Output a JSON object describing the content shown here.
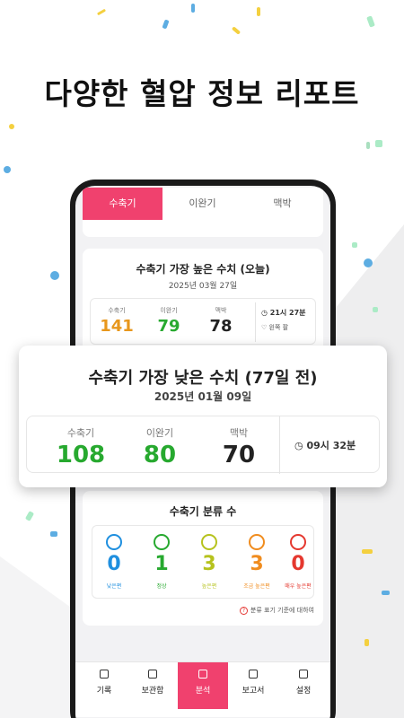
{
  "headline": "다양한 혈압 정보 리포트",
  "colors": {
    "accent": "#f0416e",
    "systolic_orange": "#e8971c",
    "green": "#27a92f",
    "dark": "#222222",
    "blue": "#1f8fdf",
    "lime": "#b6c21d",
    "orange": "#f08c1e",
    "red": "#e5382f"
  },
  "tabs": [
    {
      "label": "수축기",
      "active": true
    },
    {
      "label": "이완기",
      "active": false
    },
    {
      "label": "맥박",
      "active": false
    }
  ],
  "highest": {
    "title": "수축기 가장 높은 수치 (오늘)",
    "date": "2025년 03월 27일",
    "systolic_label": "수축기",
    "systolic": "141",
    "diastolic_label": "이완기",
    "diastolic": "79",
    "pulse_label": "맥박",
    "pulse": "78",
    "time": "21시 27분",
    "arm": "왼쪽 팔"
  },
  "lowest": {
    "title": "수축기 가장 낮은 수치 (77일 전)",
    "date": "2025년 01월 09일",
    "systolic_label": "수축기",
    "systolic": "108",
    "diastolic_label": "이완기",
    "diastolic": "80",
    "pulse_label": "맥박",
    "pulse": "70",
    "time": "09시 32분"
  },
  "classification": {
    "title": "수축기 분류 수",
    "items": [
      {
        "count": "0",
        "label": "낮은편",
        "color": "#1f8fdf"
      },
      {
        "count": "1",
        "label": "정상",
        "color": "#27a92f"
      },
      {
        "count": "3",
        "label": "높은편",
        "color": "#b6c21d"
      },
      {
        "count": "3",
        "label": "조금 높은편",
        "color": "#f08c1e"
      },
      {
        "count": "0",
        "label": "매우 높은편",
        "color": "#e5382f"
      }
    ],
    "help": "분류 표기 기준에 대하여"
  },
  "nav": [
    {
      "label": "기록",
      "active": false
    },
    {
      "label": "보관함",
      "active": false
    },
    {
      "label": "분석",
      "active": true
    },
    {
      "label": "보고서",
      "active": false
    },
    {
      "label": "설정",
      "active": false
    }
  ]
}
